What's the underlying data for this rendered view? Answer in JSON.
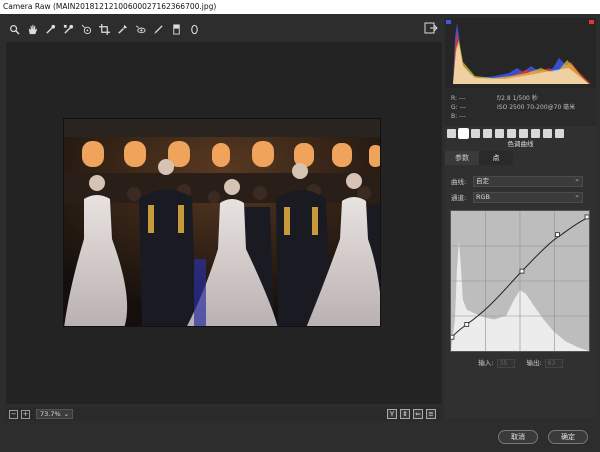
{
  "window": {
    "title": "Camera Raw (MAIN20181212100600027162366700.jpg)"
  },
  "toolbar": {
    "tools": [
      "zoom-icon",
      "hand-icon",
      "white-balance-icon",
      "color-sampler-icon",
      "targeted-adjust-icon",
      "crop-icon",
      "spot-removal-icon",
      "red-eye-icon",
      "adjustment-brush-icon",
      "graduated-filter-icon",
      "radial-filter-icon"
    ]
  },
  "status": {
    "zoom": "73.7%"
  },
  "info": {
    "r": "R:  ---",
    "g": "G:  ---",
    "b": "B:  ---",
    "aperture_shutter": "f/2.8   1/500 秒",
    "iso_lens": "ISO 2500   70-200@70 毫米"
  },
  "panel": {
    "title": "色调曲线"
  },
  "subtabs": [
    "参数",
    "点"
  ],
  "curve": {
    "label": "曲线:",
    "value": "自定",
    "channel_label": "通道:",
    "channel": "RGB"
  },
  "io": {
    "input_label": "输入:",
    "input_value": "35",
    "output_label": "输出:",
    "output_value": "63"
  },
  "buttons": {
    "cancel": "取消",
    "ok": "确定"
  },
  "colors": {
    "background": "#2d2d2d",
    "panel": "#303030",
    "curve_bg": "#bdbdbd"
  }
}
